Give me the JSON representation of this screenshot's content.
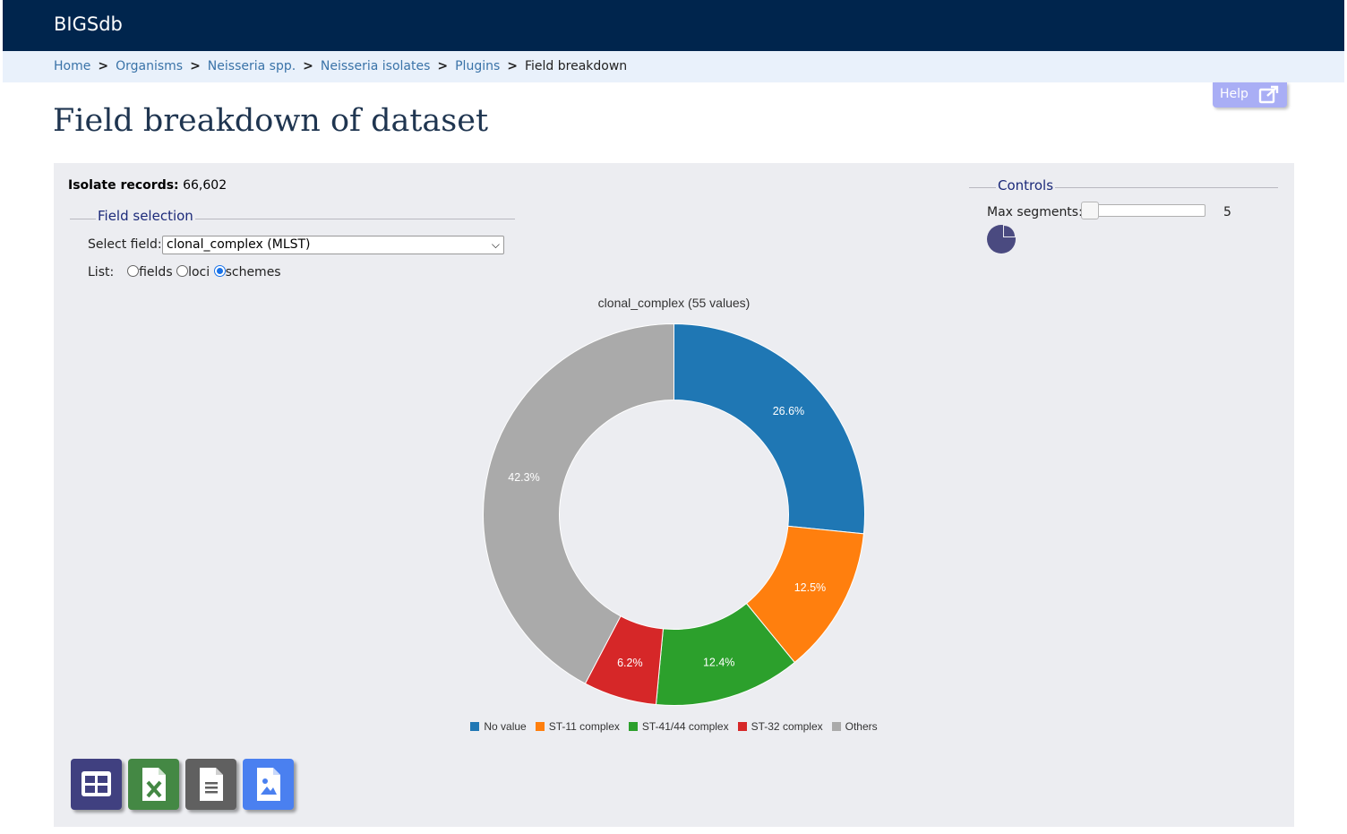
{
  "app": {
    "brand": "BIGSdb"
  },
  "breadcrumb": {
    "items": [
      "Home",
      "Organisms",
      "Neisseria spp.",
      "Neisseria isolates",
      "Plugins"
    ],
    "current": "Field breakdown",
    "separator": ">"
  },
  "help": {
    "label": "Help",
    "icon": "external-link-icon"
  },
  "page": {
    "title": "Field breakdown of dataset"
  },
  "records": {
    "label": "Isolate records:",
    "value": "66,602"
  },
  "field_selection": {
    "legend": "Field selection",
    "select_label": "Select field:",
    "selected_value": "clonal_complex (MLST)",
    "list_label": "List:",
    "options": [
      {
        "label": "fields",
        "checked": false
      },
      {
        "label": "loci",
        "checked": false
      },
      {
        "label": "schemes",
        "checked": true
      }
    ]
  },
  "controls": {
    "legend": "Controls",
    "max_segments_label": "Max segments:",
    "max_segments_value": "5",
    "chart_type_icon": "pie-chart-icon"
  },
  "chart_data": {
    "type": "pie",
    "style": "donut",
    "title": "clonal_complex (55 values)",
    "legend_position": "bottom",
    "categories": [
      "No value",
      "ST-11 complex",
      "ST-41/44 complex",
      "ST-32 complex",
      "Others"
    ],
    "values": [
      26.6,
      12.5,
      12.4,
      6.2,
      42.3
    ],
    "labels": [
      "26.6%",
      "12.5%",
      "12.4%",
      "6.2%",
      "42.3%"
    ],
    "colors": [
      "#1f77b4",
      "#ff7f0e",
      "#2ca02c",
      "#d62728",
      "#aaaaaa"
    ]
  },
  "export_buttons": [
    {
      "name": "table-export-button",
      "icon": "table-icon",
      "color": "#404080"
    },
    {
      "name": "excel-export-button",
      "icon": "excel-icon",
      "color": "#448844"
    },
    {
      "name": "text-export-button",
      "icon": "text-file-icon",
      "color": "#606060"
    },
    {
      "name": "image-export-button",
      "icon": "image-file-icon",
      "color": "#4a80f0"
    }
  ]
}
